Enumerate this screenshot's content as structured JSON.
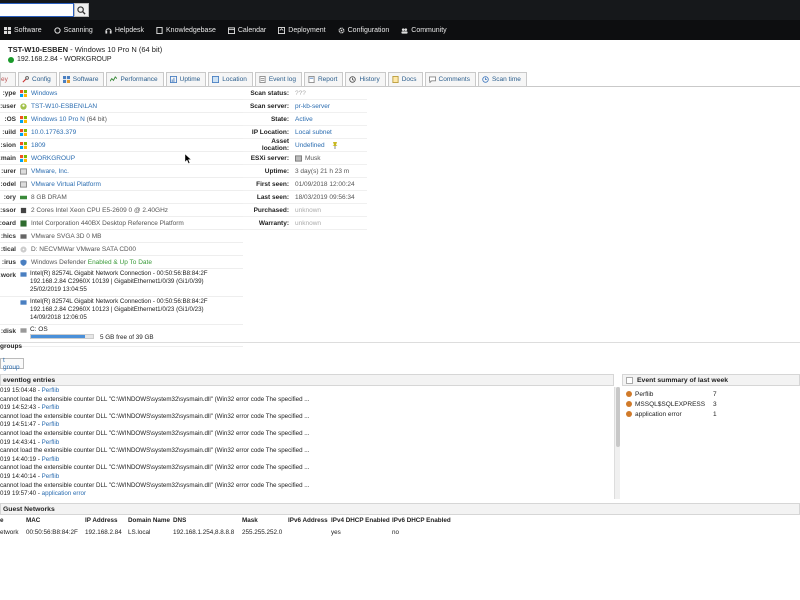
{
  "nav": {
    "items": [
      "Software",
      "Scanning",
      "Helpdesk",
      "Knowledgebase",
      "Calendar",
      "Deployment",
      "Configuration",
      "Community"
    ]
  },
  "asset": {
    "name": "TST-W10-ESBEN",
    "os_suffix": "- Windows 10 Pro N (64 bit)",
    "ip_domain": "192.168.2.84 - WORKGROUP"
  },
  "tabs": [
    "ey",
    "Config",
    "Software",
    "Performance",
    "Uptime",
    "Location",
    "Event log",
    "Report",
    "History",
    "Docs",
    "Comments",
    "Scan time"
  ],
  "summary": {
    "rows": [
      {
        "label": "ype:",
        "value": "Windows",
        "cls": "link"
      },
      {
        "label": "user:",
        "value": "TST-W10-ESBEN\\LAN",
        "cls": "link"
      },
      {
        "label": "OS:",
        "value": "Windows 10 Pro N",
        "extra": "(64 bit)",
        "cls": "link"
      },
      {
        "label": "uild:",
        "value": "10.0.17763.379",
        "cls": "link"
      },
      {
        "label": "sion:",
        "value": "1809",
        "cls": "link"
      },
      {
        "label": "main:",
        "value": "WORKGROUP",
        "cls": "link"
      },
      {
        "label": "urer:",
        "value": "VMware, Inc.",
        "cls": "link"
      },
      {
        "label": "odel:",
        "value": "VMware Virtual Platform",
        "cls": "link"
      },
      {
        "label": "ory:",
        "value": "8 GB DRAM",
        "cls": "muted"
      },
      {
        "label": "ssor:",
        "value": "2 Cores  Intel Xeon CPU E5-2609 0 @ 2.40GHz",
        "cls": "muted"
      },
      {
        "label": "oard:",
        "value": "Intel Corporation 440BX Desktop Reference Platform",
        "cls": "muted"
      },
      {
        "label": "hics:",
        "value": "VMware SVGA 3D 0 MB",
        "cls": "muted"
      },
      {
        "label": "tical:",
        "value": "D: NECVMWar VMware SATA CD00",
        "cls": "muted"
      },
      {
        "label": "irus:",
        "value": "Windows Defender",
        "extra": "Enabled & Up To Date",
        "cls": "muted"
      }
    ],
    "network_label": "work:",
    "networks": [
      {
        "line1": "Intel(R) 82574L Gigabit Network Connection  - 00:50:56:B8:84:2F",
        "line2": "192.168.2.84  C2960X  10139 | GigabitEthernet1/0/39 (Gi1/0/39)",
        "line3": "25/02/2019 13:04:55"
      },
      {
        "line1": "Intel(R) 82574L Gigabit Network Connection  - 00:50:56:B8:84:2F",
        "line2": "192.168.2.84  C2960X  10123 | GigabitEthernet1/0/23 (Gi1/0/23)",
        "line3": "14/09/2018 12:06:05"
      }
    ],
    "disk_label": "disk:",
    "disk_name": "C: OS",
    "disk_free": "5 GB free of 39 GB",
    "disk_used_fraction": 0.87
  },
  "info": {
    "rows": [
      {
        "label": "Scan status:",
        "value": "???",
        "cls": "grey"
      },
      {
        "label": "Scan server:",
        "value": "pr-kb-server",
        "cls": "link"
      },
      {
        "label": "State:",
        "value": "Active",
        "cls": "link"
      },
      {
        "label": "IP Location:",
        "value": "Local subnet",
        "cls": "link"
      },
      {
        "label": "Asset location:",
        "value": "Undefined",
        "cls": "link"
      },
      {
        "label": "ESXi server:",
        "value": "Musk",
        "cls": "muted"
      },
      {
        "label": "Uptime:",
        "value": "3 day(s) 21 h 23 m",
        "cls": "muted"
      },
      {
        "label": "First seen:",
        "value": "01/09/2018 12:00:24",
        "cls": "muted"
      },
      {
        "label": "Last seen:",
        "value": "18/03/2019 09:56:34",
        "cls": "muted"
      },
      {
        "label": "Purchased:",
        "value": "unknown",
        "cls": "grey"
      },
      {
        "label": "Warranty:",
        "value": "unknown",
        "cls": "grey"
      }
    ]
  },
  "groups": {
    "header": "groups",
    "button": "t group"
  },
  "eventlog": {
    "header": "eventlog entries",
    "entries": [
      {
        "time": "019 15:04:48 - ",
        "source": "Perflib"
      },
      {
        "msg": "cannot load the extensible counter DLL \"C:\\WINDOWS\\system32\\sysmain.dll\" (Win32 error code The specified ..."
      },
      {
        "time": "019 14:52:43 - ",
        "source": "Perflib"
      },
      {
        "msg": "cannot load the extensible counter DLL \"C:\\WINDOWS\\system32\\sysmain.dll\" (Win32 error code The specified ..."
      },
      {
        "time": "019 14:51:47 - ",
        "source": "Perflib"
      },
      {
        "msg": "cannot load the extensible counter DLL \"C:\\WINDOWS\\system32\\sysmain.dll\" (Win32 error code The specified ..."
      },
      {
        "time": "019 14:43:41 - ",
        "source": "Perflib"
      },
      {
        "msg": "cannot load the extensible counter DLL \"C:\\WINDOWS\\system32\\sysmain.dll\" (Win32 error code The specified ..."
      },
      {
        "time": "019 14:40:19 - ",
        "source": "Perflib"
      },
      {
        "msg": "cannot load the extensible counter DLL \"C:\\WINDOWS\\system32\\sysmain.dll\" (Win32 error code The specified ..."
      },
      {
        "time": "019 14:40:14 - ",
        "source": "Perflib"
      },
      {
        "msg": "cannot load the extensible counter DLL \"C:\\WINDOWS\\system32\\sysmain.dll\" (Win32 error code The specified ..."
      },
      {
        "time": "019 19:57:40 - ",
        "source": "application error"
      }
    ]
  },
  "event_summary": {
    "header": "Event summary of last week",
    "items": [
      {
        "name": "Perflib",
        "count": "7"
      },
      {
        "name": "MSSQL$SQLEXPRESS",
        "count": "3"
      },
      {
        "name": "application error",
        "count": "1"
      }
    ]
  },
  "guest_networks": {
    "header": "Guest Networks",
    "columns": [
      "e",
      "MAC",
      "IP Address",
      "Domain Name",
      "DNS",
      "Mask",
      "IPv6 Address",
      "IPv4 DHCP Enabled",
      "IPv6 DHCP Enabled"
    ],
    "rows": [
      [
        "etwork",
        "00:50:56:B8:84:2F",
        "192.168.2.84",
        "LS.local",
        "192.168.1.254,8.8.8.8",
        "255.255.252.0",
        "",
        "yes",
        "no"
      ]
    ]
  }
}
